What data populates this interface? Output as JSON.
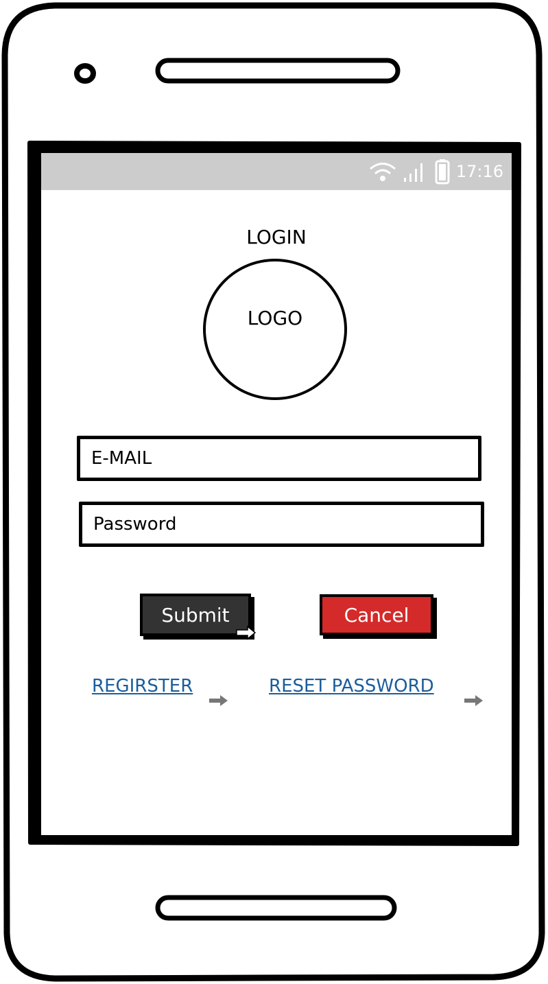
{
  "status_bar": {
    "time": "17:16",
    "icons": [
      "wifi-icon",
      "signal-icon",
      "battery-icon"
    ],
    "background": "#cccccc"
  },
  "screen": {
    "title": "LOGIN",
    "logo_label": "LOGO"
  },
  "form": {
    "email_placeholder": "E-MAIL",
    "password_placeholder": "Password"
  },
  "buttons": {
    "submit_label": "Submit",
    "cancel_label": "Cancel",
    "submit_color": "#333333",
    "cancel_color": "#d52a2a"
  },
  "links": {
    "register_label": "REGIRSTER",
    "reset_label": "RESET PASSWORD",
    "color": "#1a5d9c"
  }
}
